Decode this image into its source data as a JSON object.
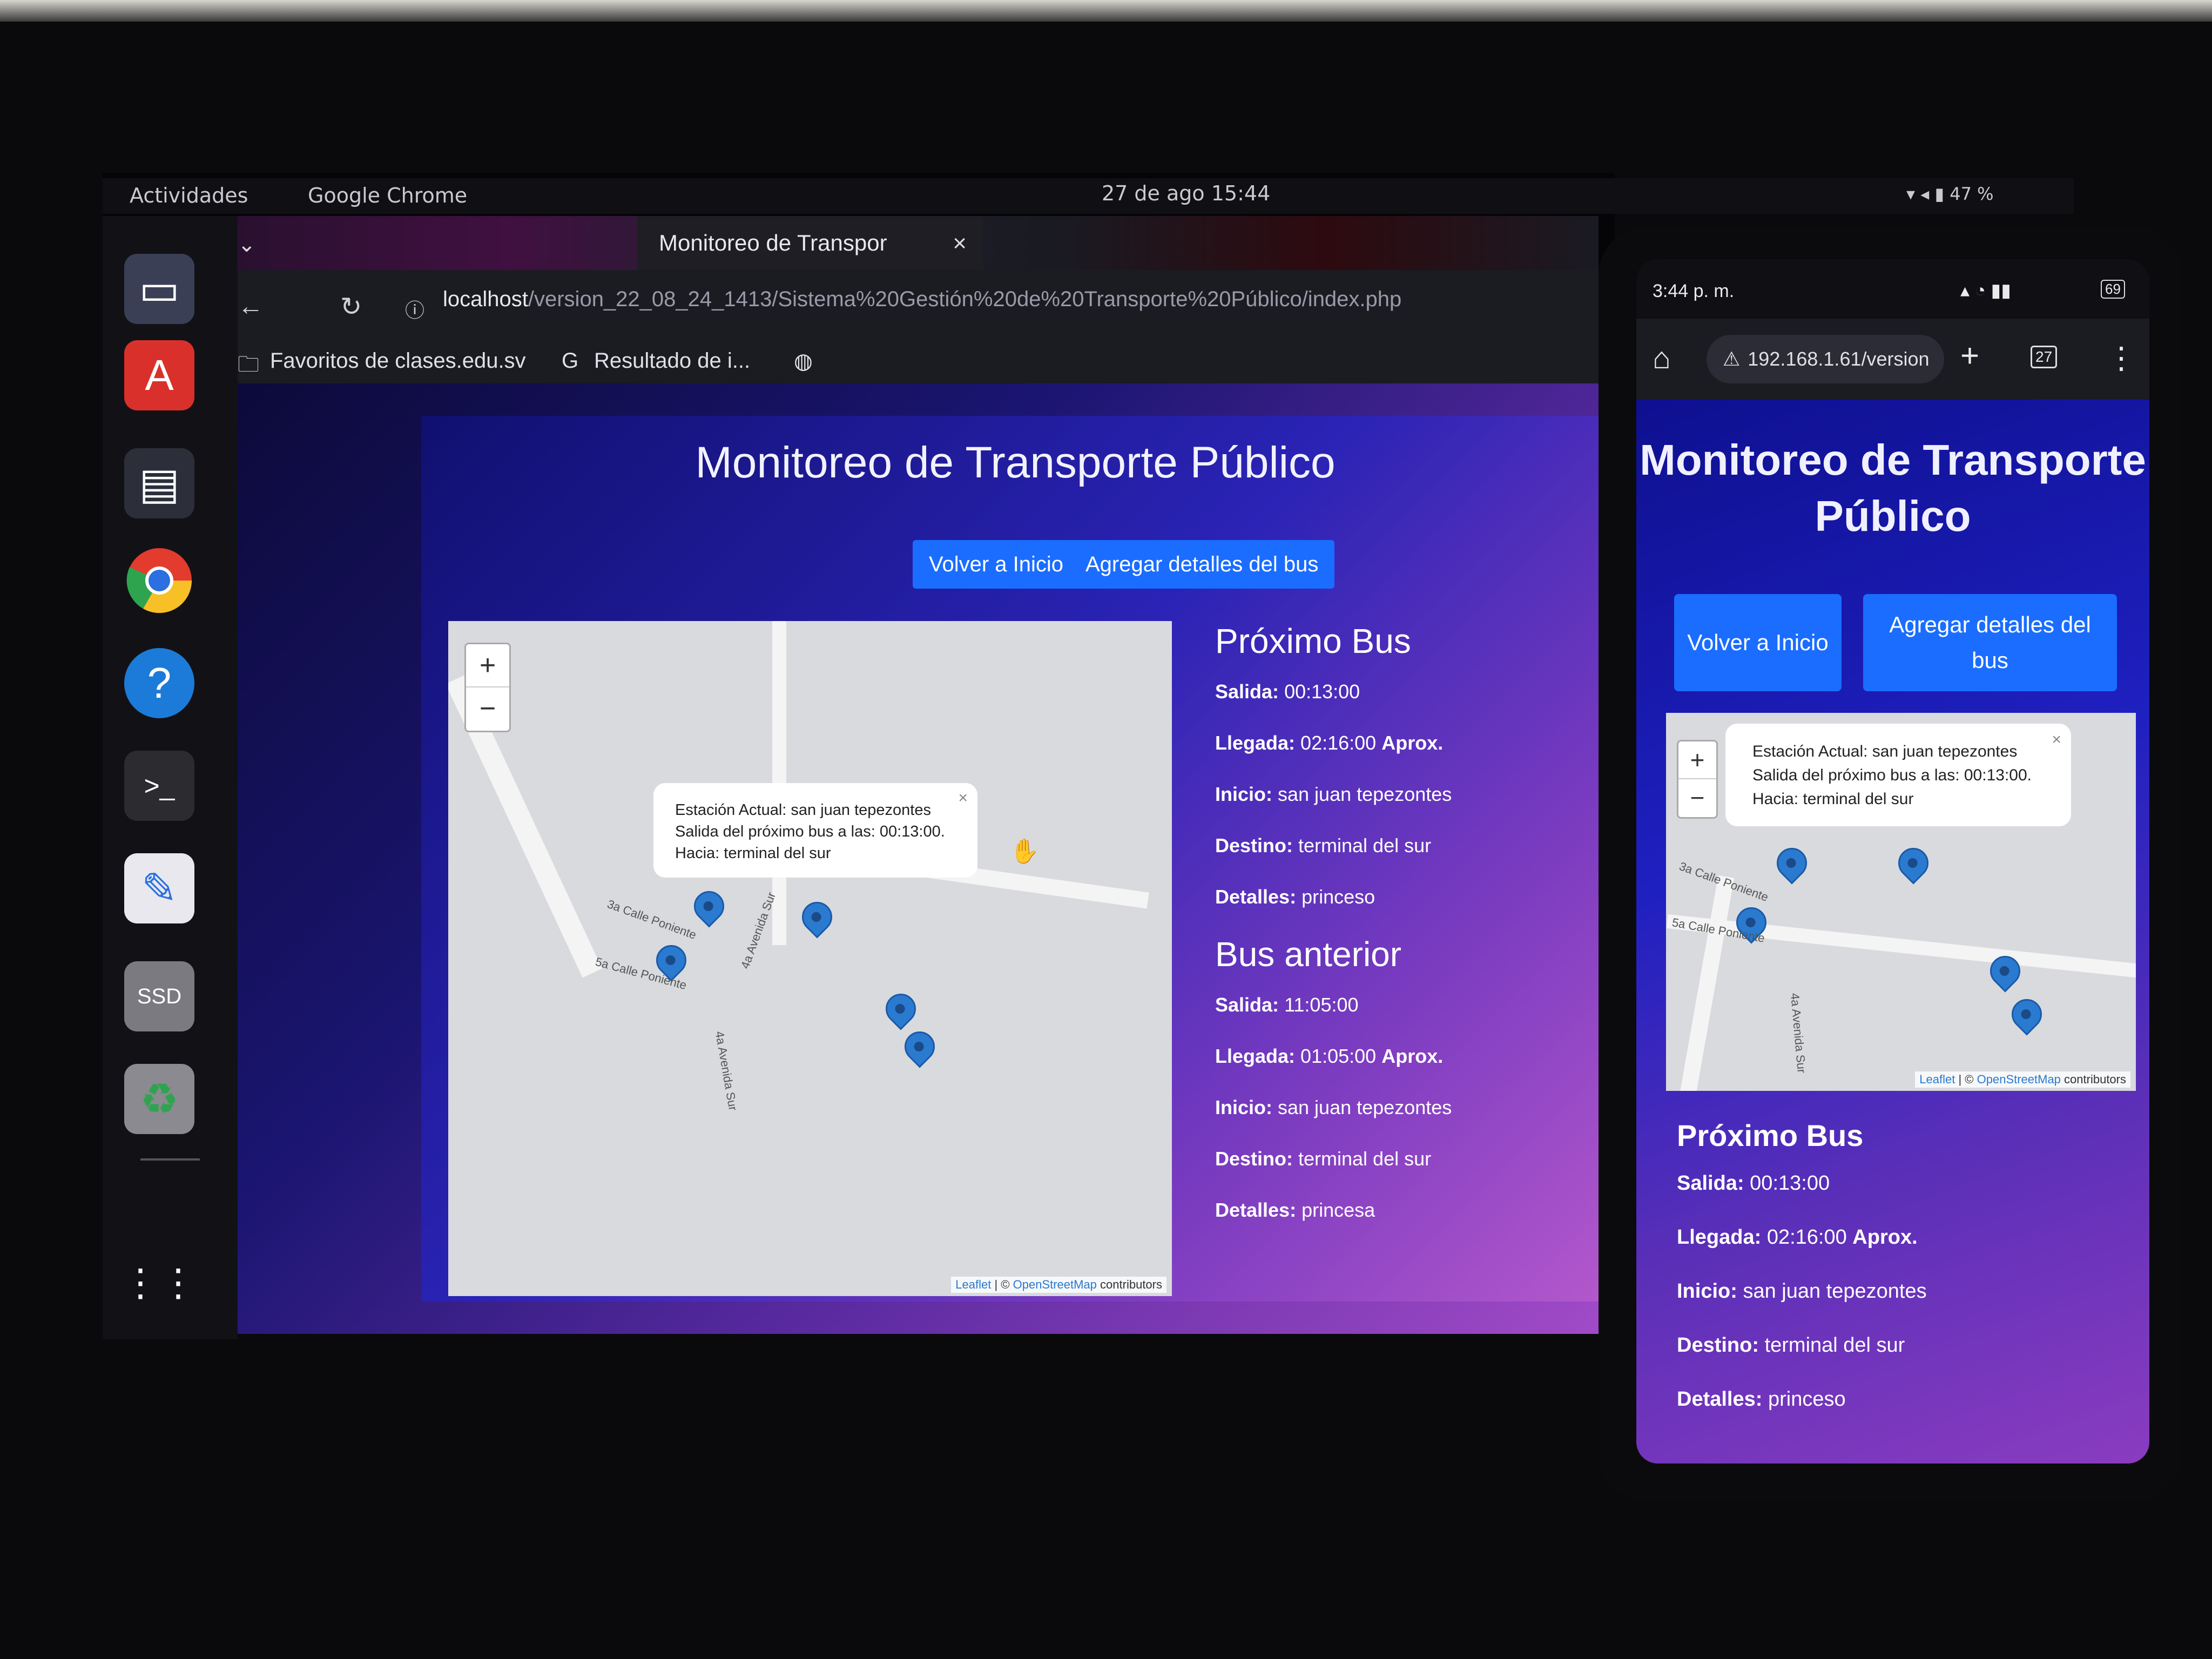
{
  "os": {
    "activities": "Actividades",
    "app_name": "Google Chrome",
    "clock": "27 de ago  15:44",
    "battery": "47 %"
  },
  "browser": {
    "tab_title": "Monitoreo de Transpor",
    "url_host": "localhost",
    "url_path": "/version_22_08_24_1413/Sistema%20Gestión%20de%20Transporte%20Público/index.php",
    "bookmarks": [
      "Favoritos de clases.edu.sv",
      "Resultado de i..."
    ]
  },
  "page": {
    "title": "Monitoreo de Transporte Público",
    "btn_home": "Volver a Inicio",
    "btn_add": "Agregar detalles del bus",
    "popup": {
      "line1": "Estación Actual: san juan tepezontes",
      "line2": "Salida del próximo bus a las: 00:13:00.",
      "line3": "Hacia: terminal del sur"
    },
    "map_attrib_leaflet": "Leaflet",
    "map_attrib_osm": "OpenStreetMap",
    "map_attrib_rest": "contributors",
    "streets": [
      "3a Calle Poniente",
      "5a Calle Poniente",
      "4a Avenida Sur",
      "4a Avenida Sur"
    ],
    "next_bus": {
      "heading": "Próximo Bus",
      "salida_label": "Salida:",
      "salida": "00:13:00",
      "llegada_label": "Llegada:",
      "llegada": "02:16:00",
      "aprox": "Aprox.",
      "inicio_label": "Inicio:",
      "inicio": "san juan tepezontes",
      "destino_label": "Destino:",
      "destino": "terminal del sur",
      "detalles_label": "Detalles:",
      "detalles": "princeso"
    },
    "prev_bus": {
      "heading": "Bus anterior",
      "salida_label": "Salida:",
      "salida": "11:05:00",
      "llegada_label": "Llegada:",
      "llegada": "01:05:00",
      "aprox": "Aprox.",
      "inicio_label": "Inicio:",
      "inicio": "san juan tepezontes",
      "destino_label": "Destino:",
      "destino": "terminal del sur",
      "detalles_label": "Detalles:",
      "detalles": "princesa"
    }
  },
  "phone": {
    "time": "3:44 p. m.",
    "url": "192.168.1.61/version",
    "tabs_count": "27",
    "battery": "69",
    "title": "Monitoreo de Transporte Público",
    "btn_home": "Volver a Inicio",
    "btn_add": "Agregar detalles del bus"
  }
}
